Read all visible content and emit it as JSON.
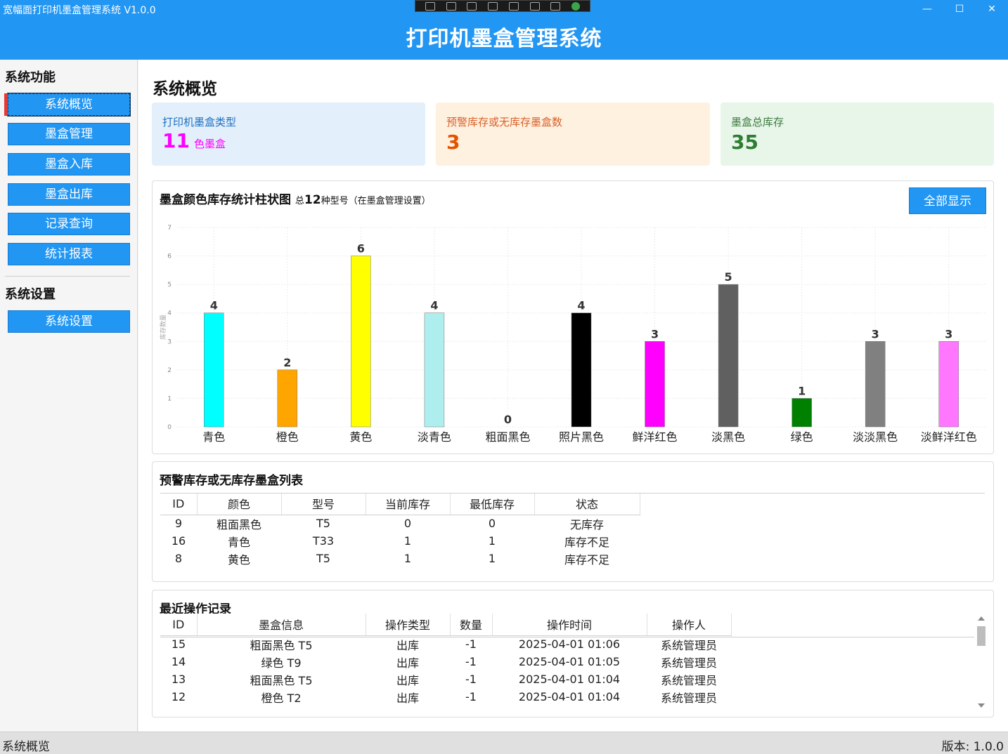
{
  "window": {
    "title": "宽幅面打印机墨盒管理系统 V1.0.0"
  },
  "banner": {
    "title": "打印机墨盒管理系统"
  },
  "sidebar": {
    "section1": "系统功能",
    "items": [
      {
        "label": "系统概览"
      },
      {
        "label": "墨盒管理"
      },
      {
        "label": "墨盒入库"
      },
      {
        "label": "墨盒出库"
      },
      {
        "label": "记录查询"
      },
      {
        "label": "统计报表"
      }
    ],
    "section2": "系统设置",
    "settings_label": "系统设置"
  },
  "page": {
    "title": "系统概览"
  },
  "cards": [
    {
      "label": "打印机墨盒类型",
      "value": "11",
      "unit": "色墨盒",
      "bg": "#e3f0fc",
      "label_color": "#1e6fc0",
      "value_color": "#ff00ff"
    },
    {
      "label": "预警库存或无库存墨盒数",
      "value": "3",
      "unit": "",
      "bg": "#fff1e0",
      "label_color": "#d8602a",
      "value_color": "#e65100"
    },
    {
      "label": "墨盒总库存",
      "value": "35",
      "unit": "",
      "bg": "#e8f5e9",
      "label_color": "#3a7a3e",
      "value_color": "#2e7d32"
    }
  ],
  "chart_panel": {
    "title": "墨盒颜色库存统计柱状图",
    "subtitle_prefix": "总",
    "subtitle_count": "12",
    "subtitle_suffix": "种型号（在墨盒管理设置）",
    "button": "全部显示"
  },
  "chart_data": {
    "type": "bar",
    "categories": [
      "青色",
      "橙色",
      "黄色",
      "淡青色",
      "粗面黑色",
      "照片黑色",
      "鲜洋红色",
      "淡黑色",
      "绿色",
      "淡淡黑色",
      "淡鲜洋红色"
    ],
    "values": [
      4,
      2,
      6,
      4,
      0,
      4,
      3,
      5,
      1,
      3,
      3
    ],
    "colors": [
      "#00ffff",
      "#ffa500",
      "#ffff00",
      "#afeeee",
      "#000000",
      "#000000",
      "#ff00ff",
      "#606060",
      "#008000",
      "#808080",
      "#ff77ff"
    ],
    "ylabel": "库存数量",
    "ylim": [
      0,
      7
    ],
    "yticks": [
      "0",
      "1",
      "2",
      "3",
      "4",
      "5",
      "6",
      "7"
    ],
    "grid": true
  },
  "warning_panel": {
    "title": "预警库存或无库存墨盒列表",
    "headers": [
      "ID",
      "颜色",
      "型号",
      "当前库存",
      "最低库存",
      "状态"
    ],
    "rows": [
      [
        "9",
        "粗面黑色",
        "T5",
        "0",
        "0",
        "无库存"
      ],
      [
        "16",
        "青色",
        "T33",
        "1",
        "1",
        "库存不足"
      ],
      [
        "8",
        "黄色",
        "T5",
        "1",
        "1",
        "库存不足"
      ]
    ]
  },
  "records_panel": {
    "title": "最近操作记录",
    "headers": [
      "ID",
      "墨盒信息",
      "操作类型",
      "数量",
      "操作时间",
      "操作人"
    ],
    "rows": [
      [
        "15",
        "粗面黑色  T5",
        "出库",
        "-1",
        "2025-04-01  01:06",
        "系统管理员"
      ],
      [
        "14",
        "绿色  T9",
        "出库",
        "-1",
        "2025-04-01  01:05",
        "系统管理员"
      ],
      [
        "13",
        "粗面黑色  T5",
        "出库",
        "-1",
        "2025-04-01  01:04",
        "系统管理员"
      ],
      [
        "12",
        "橙色  T2",
        "出库",
        "-1",
        "2025-04-01  01:04",
        "系统管理员"
      ]
    ]
  },
  "statusbar": {
    "left": "系统概览",
    "right": "版本: 1.0.0"
  }
}
